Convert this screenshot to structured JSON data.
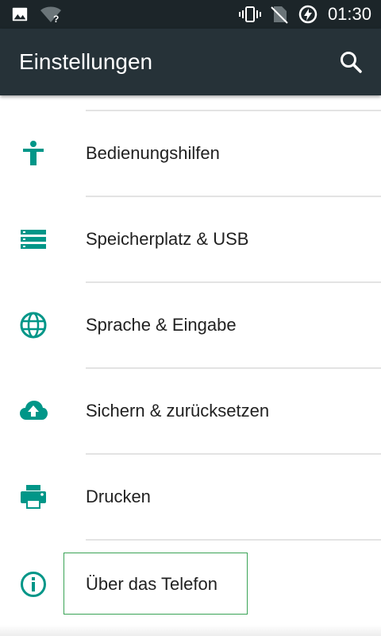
{
  "status_bar": {
    "time": "01:30",
    "icons": [
      "image-icon",
      "wifi-unknown-icon",
      "vibrate-icon",
      "no-sim-icon",
      "battery-charging-icon"
    ]
  },
  "app_bar": {
    "title": "Einstellungen",
    "search_icon": "search-icon"
  },
  "settings_items": [
    {
      "label": "Bedienungshilfen",
      "icon": "accessibility-icon"
    },
    {
      "label": "Speicherplatz & USB",
      "icon": "storage-icon"
    },
    {
      "label": "Sprache & Eingabe",
      "icon": "language-globe-icon"
    },
    {
      "label": "Sichern & zurücksetzen",
      "icon": "backup-cloud-icon"
    },
    {
      "label": "Drucken",
      "icon": "printer-icon"
    },
    {
      "label": "Über das Telefon",
      "icon": "info-icon"
    }
  ],
  "colors": {
    "accent": "#009688",
    "app_bar": "#263238",
    "status_bar": "#1c2529",
    "focus_outline": "#3aa356"
  }
}
